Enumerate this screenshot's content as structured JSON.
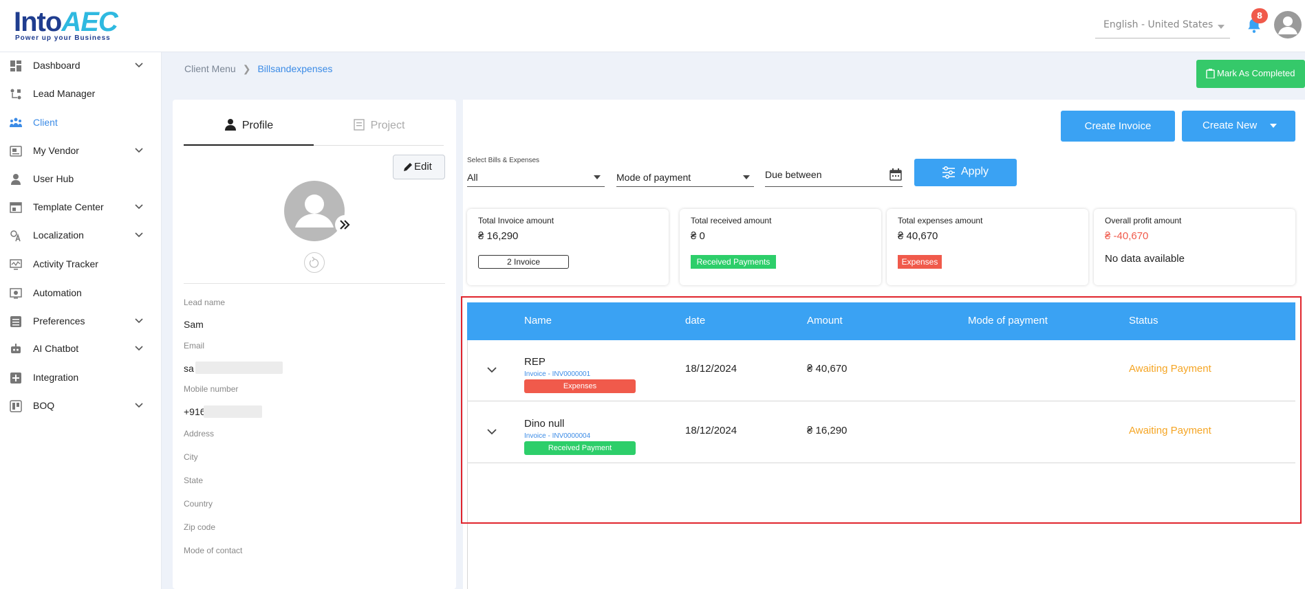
{
  "header": {
    "logo_word": "Into",
    "logo_accent": "AEC",
    "logo_tagline": "Power up your Business",
    "language": "English - United States",
    "notification_count": "8"
  },
  "sidebar": {
    "items": [
      {
        "label": "Dashboard",
        "icon": "dashboard-icon",
        "has_chevron": true
      },
      {
        "label": "Lead Manager",
        "icon": "lead-manager-icon",
        "has_chevron": false
      },
      {
        "label": "Client",
        "icon": "client-icon",
        "has_chevron": false,
        "active": true
      },
      {
        "label": "My Vendor",
        "icon": "vendor-icon",
        "has_chevron": true
      },
      {
        "label": "User Hub",
        "icon": "user-icon",
        "has_chevron": false
      },
      {
        "label": "Template Center",
        "icon": "template-icon",
        "has_chevron": true
      },
      {
        "label": "Localization",
        "icon": "localization-icon",
        "has_chevron": true
      },
      {
        "label": "Activity Tracker",
        "icon": "activity-icon",
        "has_chevron": false
      },
      {
        "label": "Automation",
        "icon": "automation-icon",
        "has_chevron": false
      },
      {
        "label": "Preferences",
        "icon": "preferences-icon",
        "has_chevron": true
      },
      {
        "label": "AI Chatbot",
        "icon": "chatbot-icon",
        "has_chevron": true
      },
      {
        "label": "Integration",
        "icon": "integration-icon",
        "has_chevron": false
      },
      {
        "label": "BOQ",
        "icon": "boq-icon",
        "has_chevron": true
      }
    ]
  },
  "breadcrumb": {
    "parent": "Client Menu",
    "current": "Billsandexpenses"
  },
  "actions": {
    "mark_completed": "Mark As Completed",
    "create_invoice": "Create Invoice",
    "create_new": "Create New",
    "apply": "Apply",
    "edit": "Edit"
  },
  "profile": {
    "tab_profile": "Profile",
    "tab_project": "Project",
    "fields": {
      "lead_name_label": "Lead name",
      "lead_name_value": "Sam",
      "email_label": "Email",
      "email_value": "sa",
      "mobile_label": "Mobile number",
      "mobile_value": "+916",
      "address_label": "Address",
      "city_label": "City",
      "state_label": "State",
      "country_label": "Country",
      "zip_label": "Zip code",
      "contact_label": "Mode of contact"
    }
  },
  "filters": {
    "bills_label": "Select Bills & Expenses",
    "bills_value": "All",
    "mode_placeholder": "Mode of payment",
    "due_placeholder": "Due between"
  },
  "summary": {
    "total_invoice": {
      "title": "Total Invoice amount",
      "value": "₴ 16,290",
      "pill": "2 Invoice"
    },
    "total_received": {
      "title": "Total received amount",
      "value": "₴ 0",
      "pill": "Received Payments"
    },
    "total_expenses": {
      "title": "Total expenses amount",
      "value": "₴ 40,670",
      "pill": "Expenses"
    },
    "overall_profit": {
      "title": "Overall profit amount",
      "value": "₴ -40,670",
      "note": "No data available"
    }
  },
  "table": {
    "columns": [
      "Name",
      "date",
      "Amount",
      "Mode of payment",
      "Status"
    ],
    "rows": [
      {
        "name": "REP",
        "invoice": "Invoice - INV0000001",
        "tag": "Expenses",
        "tag_color": "#f05a4b",
        "date": "18/12/2024",
        "amount": "₴ 40,670",
        "mode": "",
        "status": "Awaiting Payment"
      },
      {
        "name": "Dino null",
        "invoice": "Invoice - INV0000004",
        "tag": "Received Payment",
        "tag_color": "#2dce6a",
        "date": "18/12/2024",
        "amount": "₴ 16,290",
        "mode": "",
        "status": "Awaiting Payment"
      }
    ]
  },
  "colors": {
    "primary": "#3aa2f3",
    "success": "#35c96a",
    "danger": "#f05a4b",
    "warning": "#f5a524",
    "highlight": "#e0242c"
  }
}
